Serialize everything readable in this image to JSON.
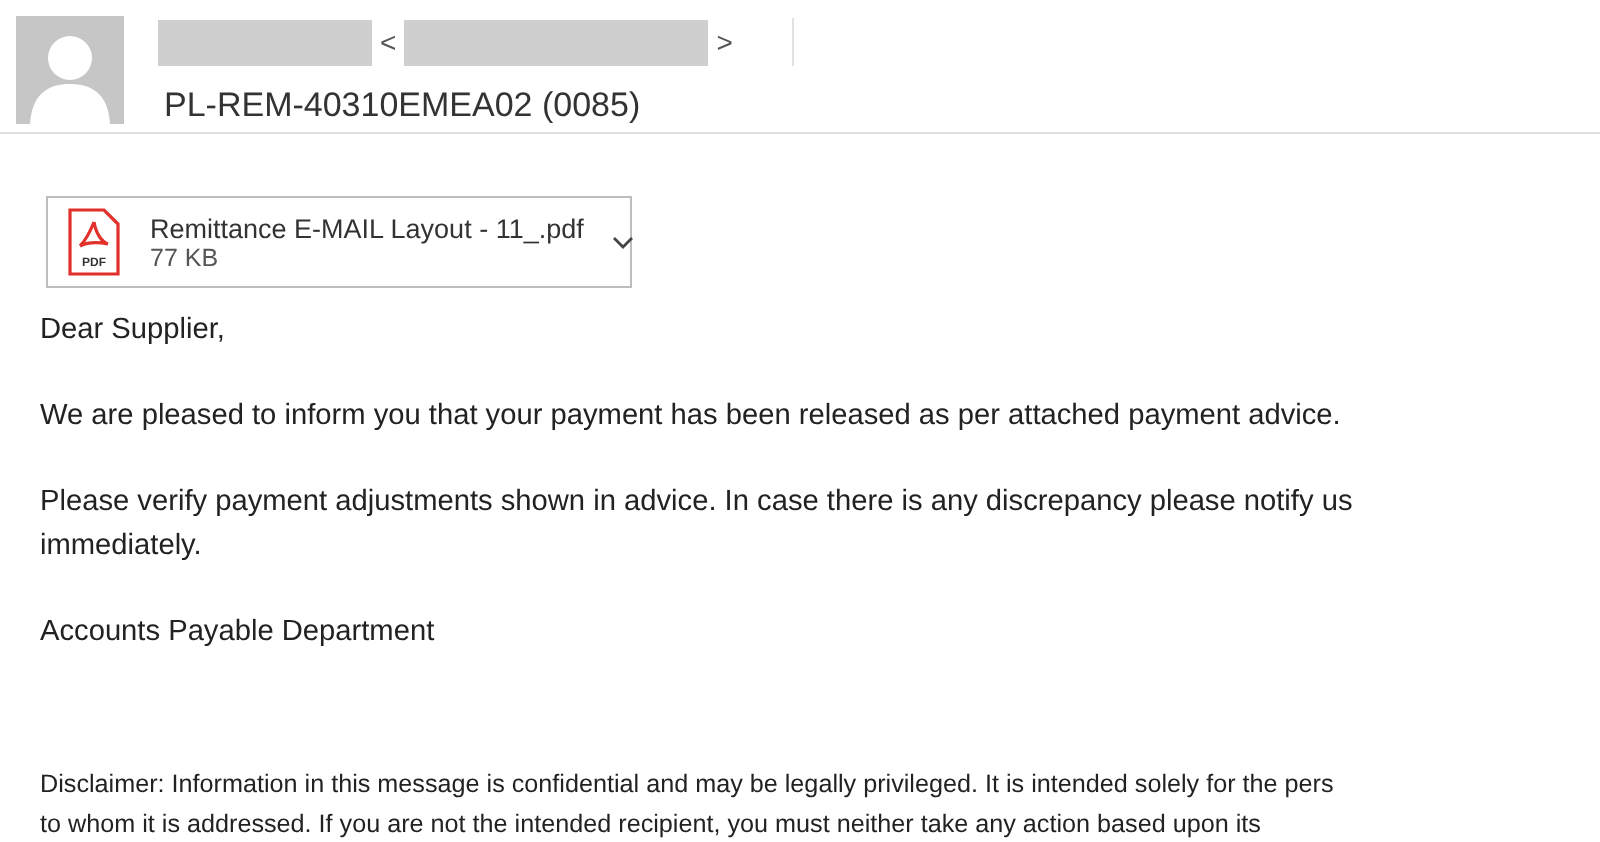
{
  "header": {
    "sender_open": "<",
    "sender_close": ">",
    "subject": "PL-REM-40310EMEA02 (0085)"
  },
  "attachment": {
    "kind": "pdf",
    "badge": "PDF",
    "name": "Remittance E-MAIL Layout - 11_.pdf",
    "size": "77 KB"
  },
  "body": [
    "Dear Supplier,",
    "We are pleased to inform you that your payment has been released as per attached payment advice.",
    "Please verify payment adjustments shown in advice. In case there is any discrepancy please notify us immediately.",
    "Accounts Payable Department"
  ],
  "disclaimer": [
    "Disclaimer: Information in this message is confidential and may be legally privileged. It is intended solely for the pers",
    "to whom it is addressed. If you are not the intended recipient, you must neither take any action based upon its"
  ]
}
